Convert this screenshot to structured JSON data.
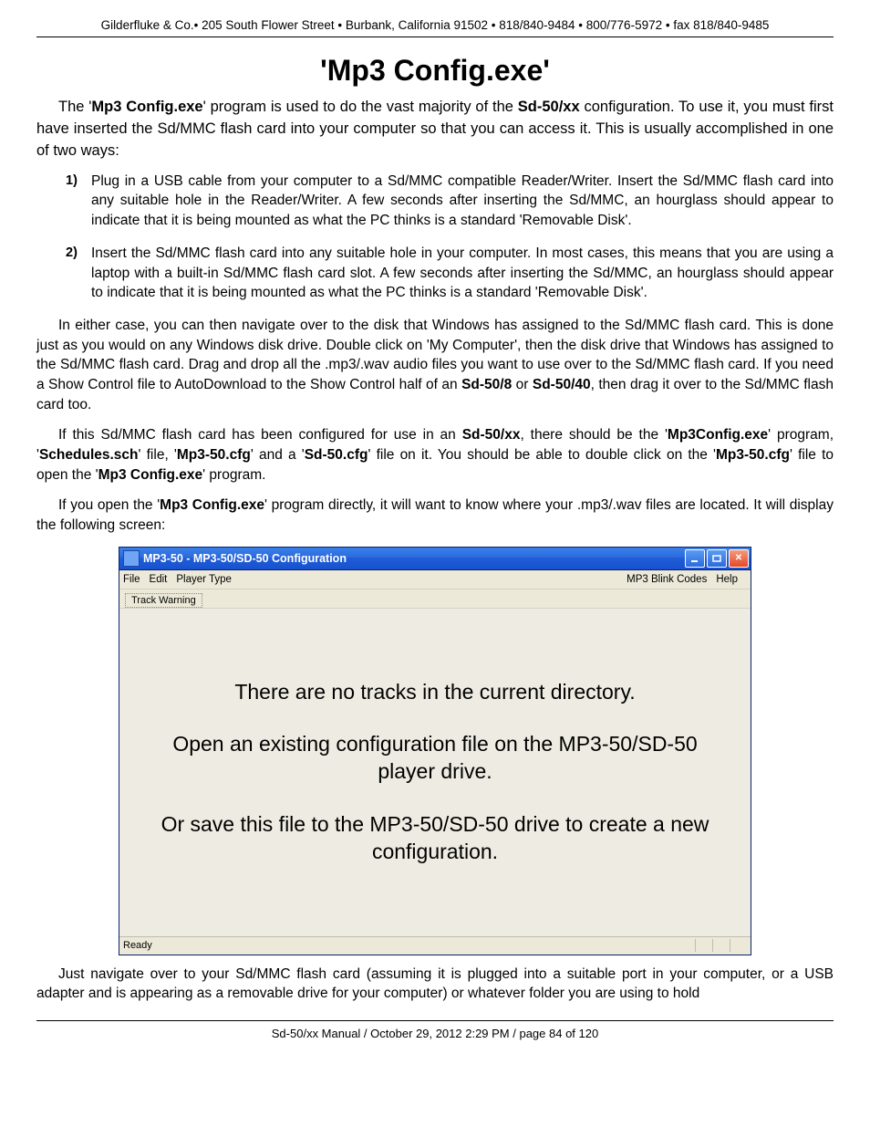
{
  "header": {
    "line": "Gilderfluke & Co.• 205 South Flower Street • Burbank, California 91502 • 818/840-9484 • 800/776-5972 • fax 818/840-9485"
  },
  "title": "'Mp3 Config.exe'",
  "intro": {
    "pre": "The '",
    "b1": "Mp3 Config.exe",
    "mid1": "' program is used to do the vast majority of the ",
    "b2": "Sd-50/xx",
    "post": " configuration. To use it, you must first have inserted the Sd/MMC flash card into your computer so that you can access it. This is usually accomplished in one of two ways:"
  },
  "steps": {
    "n1": "1)",
    "s1": "Plug in a USB cable from your computer to a Sd/MMC compatible Reader/Writer. Insert the Sd/MMC flash card into any suitable hole in the Reader/Writer. A few seconds after inserting the Sd/MMC, an hourglass should appear to indicate that it is being mounted as what the PC thinks is a standard 'Removable Disk'.",
    "n2": "2)",
    "s2": "Insert the Sd/MMC flash card into any suitable hole in your computer. In most cases, this means that you are using a laptop with a built-in Sd/MMC flash card slot. A few seconds after inserting the Sd/MMC, an hourglass should appear to indicate that it is being mounted as what the PC thinks is a standard 'Removable Disk'."
  },
  "p3": {
    "t1": "In either case, you can then navigate over to the disk that Windows has assigned to the Sd/MMC flash card. This is done just as you would on any Windows disk drive. Double click on 'My Computer', then the disk drive that Windows has assigned to the Sd/MMC flash card. Drag and drop all the .mp3/.wav audio files you want to use over to the Sd/MMC flash card. If you need a Show Control file to AutoDownload to the Show Control half of an ",
    "b1": "Sd-50/8",
    "t2": " or ",
    "b2": "Sd-50/40",
    "t3": ", then drag it over to the Sd/MMC flash card too."
  },
  "p4": {
    "t1": "If this Sd/MMC flash card has been configured for use in an ",
    "b1": "Sd-50/xx",
    "t2": ", there should be the '",
    "b2": "Mp3Config.exe",
    "t3": "' program, '",
    "b3": "Schedules.sch",
    "t4": "' file, '",
    "b4": "Mp3-50.cfg",
    "t5": "' and a '",
    "b5": "Sd-50.cfg",
    "t6": "' file on it. You should be able to double click on the '",
    "b6": "Mp3-50.cfg",
    "t7": "' file to open the '",
    "b7": "Mp3 Config.exe",
    "t8": "' program."
  },
  "p5": {
    "t1": "If you open the '",
    "b1": "Mp3 Config.exe",
    "t2": "' program directly, it will want to know where your .mp3/.wav files are located. It will display the following screen:"
  },
  "app": {
    "title": "MP3-50 - MP3-50/SD-50 Configuration",
    "menu": {
      "file": "File",
      "edit": "Edit",
      "player": "Player Type",
      "blink": "MP3 Blink Codes",
      "help": "Help"
    },
    "tab": "Track Warning",
    "msg1": "There are no tracks in the current directory.",
    "msg2": "Open an existing configuration file on the MP3-50/SD-50 player drive.",
    "msg3": "Or save this file to the MP3-50/SD-50 drive to create a new configuration.",
    "status": "Ready"
  },
  "p6": "Just navigate over to your Sd/MMC flash card (assuming it is plugged into a suitable port in your computer, or a USB adapter and is appearing as a removable drive for your computer) or whatever folder you are using to hold",
  "footer": "Sd-50/xx Manual / October 29, 2012 2:29 PM / page 84 of 120"
}
